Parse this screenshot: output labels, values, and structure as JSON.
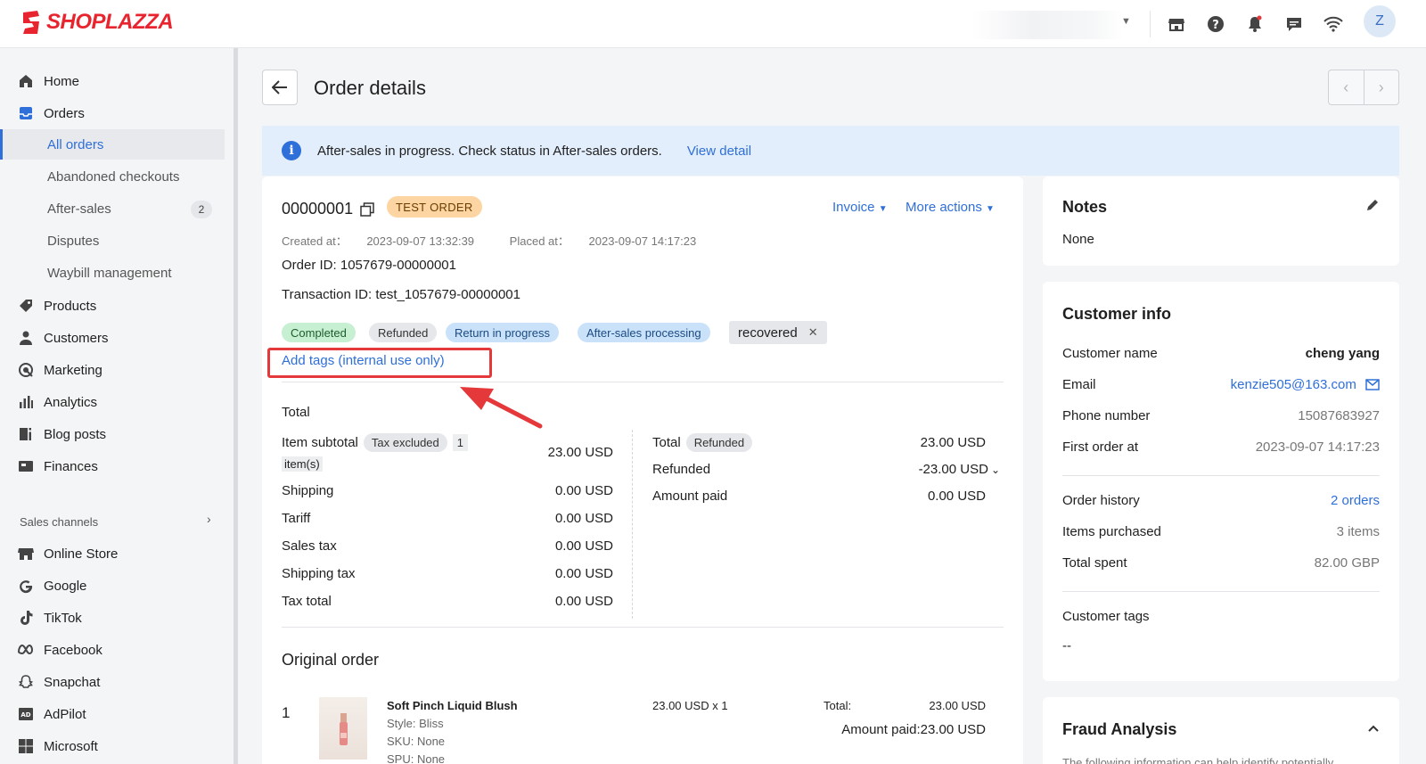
{
  "brand": {
    "name": "SHOPLAZZA",
    "accent": "#e8242f"
  },
  "topbar": {
    "icons": [
      "store-icon",
      "help-icon",
      "bell-icon",
      "chat-icon",
      "wifi-icon"
    ],
    "avatar_initial": "Z"
  },
  "sidebar": {
    "items": [
      {
        "label": "Home",
        "icon": "home-icon"
      },
      {
        "label": "Orders",
        "icon": "orders-icon"
      },
      {
        "label": "Products",
        "icon": "tag-icon"
      },
      {
        "label": "Customers",
        "icon": "person-icon"
      },
      {
        "label": "Marketing",
        "icon": "marketing-icon"
      },
      {
        "label": "Analytics",
        "icon": "chart-icon"
      },
      {
        "label": "Blog posts",
        "icon": "blog-icon"
      },
      {
        "label": "Finances",
        "icon": "finance-icon"
      }
    ],
    "order_sub": [
      {
        "label": "All orders",
        "active": true
      },
      {
        "label": "Abandoned checkouts"
      },
      {
        "label": "After-sales",
        "count": "2"
      },
      {
        "label": "Disputes"
      },
      {
        "label": "Waybill management"
      }
    ],
    "sales_channels_label": "Sales channels",
    "channels": [
      {
        "label": "Online Store",
        "icon": "store-icon"
      },
      {
        "label": "Google",
        "icon": "google-icon"
      },
      {
        "label": "TikTok",
        "icon": "tiktok-icon"
      },
      {
        "label": "Facebook",
        "icon": "meta-icon"
      },
      {
        "label": "Snapchat",
        "icon": "snapchat-icon"
      },
      {
        "label": "AdPilot",
        "icon": "adpilot-icon"
      },
      {
        "label": "Microsoft",
        "icon": "microsoft-icon"
      }
    ]
  },
  "page": {
    "title": "Order details"
  },
  "banner": {
    "text": "After-sales in progress. Check status in After-sales orders.",
    "link": "View detail",
    "bg": "#e3eefc"
  },
  "order": {
    "number": "00000001",
    "test_badge": "TEST ORDER",
    "invoice_label": "Invoice",
    "more_actions_label": "More actions",
    "created_label": "Created at：",
    "created_at": "2023-09-07 13:32:39",
    "placed_label": "Placed at：",
    "placed_at": "2023-09-07 14:17:23",
    "order_id_label": "Order ID:",
    "order_id": "1057679-00000001",
    "transaction_label": "Transaction ID:",
    "transaction_id": "test_1057679-00000001",
    "status_tags": [
      {
        "label": "Completed",
        "color": "#c7efd1"
      },
      {
        "label": "Refunded",
        "color": "#e6e7ea"
      },
      {
        "label": "Return in progress",
        "color": "#c9e2fa"
      },
      {
        "label": "After-sales processing",
        "color": "#c9e2fa"
      }
    ],
    "custom_tag": "recovered",
    "add_tags_label": "Add tags (internal use only)"
  },
  "totals": {
    "section_title": "Total",
    "item_subtotal_label": "Item subtotal",
    "tax_excluded_badge": "Tax excluded",
    "item_count": "1",
    "items_suffix": "item(s)",
    "item_subtotal": "23.00 USD",
    "rows": [
      {
        "label": "Shipping",
        "value": "0.00 USD"
      },
      {
        "label": "Tariff",
        "value": "0.00 USD"
      },
      {
        "label": "Sales tax",
        "value": "0.00 USD"
      },
      {
        "label": "Shipping tax",
        "value": "0.00 USD"
      },
      {
        "label": "Tax total",
        "value": "0.00 USD"
      }
    ],
    "total_label": "Total",
    "refunded_badge": "Refunded",
    "total_value": "23.00 USD",
    "refunded_label": "Refunded",
    "refunded_value": "-23.00 USD",
    "amount_paid_label": "Amount paid",
    "amount_paid_value": "0.00 USD"
  },
  "original_order": {
    "title": "Original order",
    "index": "1",
    "name": "Soft Pinch Liquid Blush",
    "style": "Style: Bliss",
    "sku": "SKU: None",
    "spu": "SPU: None",
    "price_qty": "23.00 USD x 1",
    "total_label": "Total:",
    "total_value": "23.00 USD",
    "amount_paid": "Amount paid:23.00 USD"
  },
  "notes": {
    "title": "Notes",
    "value": "None"
  },
  "customer": {
    "title": "Customer info",
    "rows": [
      {
        "label": "Customer name",
        "value": "cheng yang"
      },
      {
        "label": "Email",
        "value": "kenzie505@163.com"
      },
      {
        "label": "Phone number",
        "value": "15087683927"
      },
      {
        "label": "First order at",
        "value": "2023-09-07 14:17:23"
      }
    ],
    "history": [
      {
        "label": "Order history",
        "value": "2 orders"
      },
      {
        "label": "Items purchased",
        "value": "3 items"
      },
      {
        "label": "Total spent",
        "value": "82.00 GBP"
      }
    ],
    "tags_label": "Customer tags",
    "tags_value": "--"
  },
  "fraud": {
    "title": "Fraud Analysis",
    "preview": "The following information can help identify potentially"
  }
}
